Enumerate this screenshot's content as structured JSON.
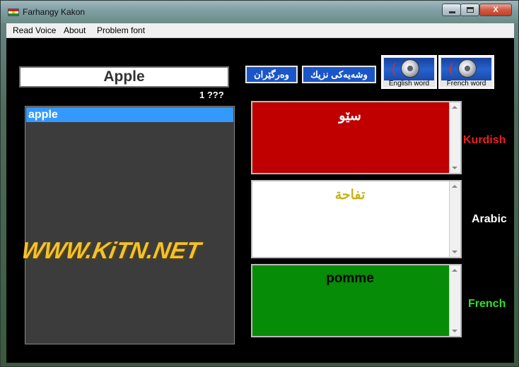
{
  "window": {
    "title": "Farhangy Kakon",
    "icon": "kurdistan-flag-icon",
    "minimize_icon": "minimize-icon",
    "maximize_icon": "maximize-icon",
    "close_label": "X"
  },
  "menu": {
    "items": [
      {
        "label": "Read Voice"
      },
      {
        "label": "About"
      },
      {
        "label": "Problem font"
      }
    ]
  },
  "search": {
    "value": "Apple",
    "result_count": "1 ???"
  },
  "word_list": {
    "items": [
      "apple"
    ],
    "selected": "apple"
  },
  "logo_text": "WWW.KiTN.NET",
  "buttons": {
    "translate_label": "وەرگێران",
    "similar_label": "وشەیەکی نزیك",
    "english_word_label": "English word",
    "french_word_label": "French word",
    "sound_icon": "speaker-icon"
  },
  "translations": {
    "kurdish": {
      "label": "Kurdish",
      "text": "سێو",
      "color": "#c00000"
    },
    "arabic": {
      "label": "Arabic",
      "text": "تفاحة",
      "color": "#ffffff"
    },
    "french": {
      "label": "French",
      "text": "pomme",
      "color": "#078c07"
    }
  }
}
